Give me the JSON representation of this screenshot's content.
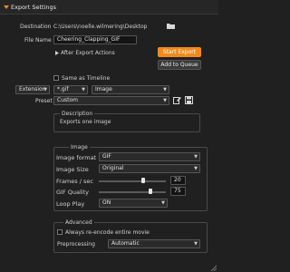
{
  "header": {
    "title": "Export Settings"
  },
  "destination": {
    "label": "Destination",
    "path": "C:\\Users\\noelle.wilmering\\Desktop"
  },
  "file_name": {
    "label": "File Name",
    "value": "Cheering_Clapping_GIF"
  },
  "after_export": {
    "label": "After Export Actions"
  },
  "buttons": {
    "start_export": "Start Export",
    "add_to_queue": "Add to Queue"
  },
  "same_as_timeline": {
    "label": "Same as Timeline"
  },
  "format_row": {
    "mode": "Extension",
    "ext": "*.gif",
    "type": "Image"
  },
  "preset": {
    "label": "Preset",
    "value": "Custom"
  },
  "description": {
    "title": "Description",
    "text": "Exports one image"
  },
  "image": {
    "title": "Image",
    "format": {
      "label": "Image format",
      "value": "GIF"
    },
    "size": {
      "label": "Image Size",
      "value": "Original"
    },
    "fps": {
      "label": "Frames / sec",
      "value": "20"
    },
    "quality": {
      "label": "GIF Quality",
      "value": "75"
    },
    "loop": {
      "label": "Loop Play",
      "value": "ON"
    }
  },
  "advanced": {
    "title": "Advanced",
    "reencode": {
      "label": "Always re-encode entire movie"
    },
    "preprocessing": {
      "label": "Preprocessing",
      "value": "Automatic"
    }
  },
  "colors": {
    "accent": "#f08a1c"
  }
}
